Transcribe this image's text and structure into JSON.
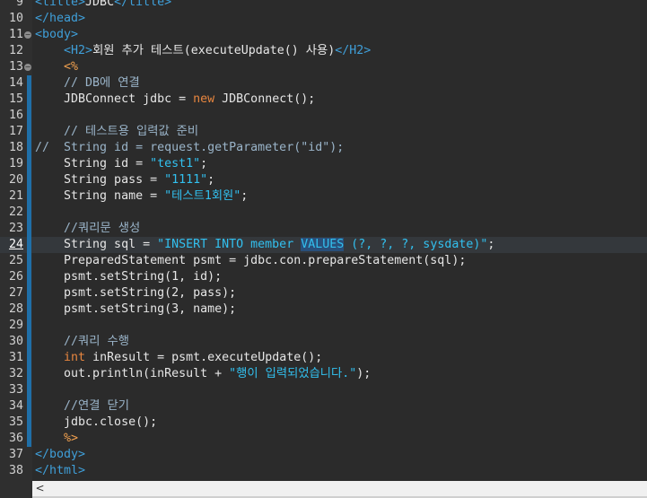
{
  "editor": {
    "lines": [
      {
        "n": "9",
        "fold": false,
        "bar": false,
        "segs": [
          {
            "c": "tag",
            "t": "<title>"
          },
          {
            "c": "plain",
            "t": "JDBC"
          },
          {
            "c": "tag",
            "t": "</title>"
          }
        ]
      },
      {
        "n": "10",
        "fold": false,
        "bar": false,
        "segs": [
          {
            "c": "tag",
            "t": "</head>"
          }
        ]
      },
      {
        "n": "11",
        "fold": true,
        "bar": false,
        "segs": [
          {
            "c": "tag",
            "t": "<body>"
          }
        ]
      },
      {
        "n": "12",
        "fold": false,
        "bar": false,
        "segs": [
          {
            "c": "plain",
            "t": "    "
          },
          {
            "c": "h2tag",
            "t": "<H2>"
          },
          {
            "c": "plain",
            "t": "회원 추가 테스트(executeUpdate() 사용)"
          },
          {
            "c": "h2tag",
            "t": "</H2>"
          }
        ]
      },
      {
        "n": "13",
        "fold": true,
        "bar": false,
        "segs": [
          {
            "c": "plain",
            "t": "    "
          },
          {
            "c": "scriptlet",
            "t": "<%"
          }
        ]
      },
      {
        "n": "14",
        "fold": false,
        "bar": true,
        "segs": [
          {
            "c": "comment",
            "t": "    // DB에 연결"
          }
        ]
      },
      {
        "n": "15",
        "fold": false,
        "bar": true,
        "segs": [
          {
            "c": "plain",
            "t": "    JDBConnect jdbc = "
          },
          {
            "c": "kw",
            "t": "new"
          },
          {
            "c": "plain",
            "t": " JDBConnect();"
          }
        ]
      },
      {
        "n": "16",
        "fold": false,
        "bar": true,
        "segs": []
      },
      {
        "n": "17",
        "fold": false,
        "bar": true,
        "segs": [
          {
            "c": "comment",
            "t": "    // 테스트용 입력값 준비"
          }
        ]
      },
      {
        "n": "18",
        "fold": false,
        "bar": true,
        "segs": [
          {
            "c": "comment",
            "t": "//  String id = request.getParameter(\"id\");"
          }
        ]
      },
      {
        "n": "19",
        "fold": false,
        "bar": true,
        "segs": [
          {
            "c": "plain",
            "t": "    String id = "
          },
          {
            "c": "str",
            "t": "\"test1\""
          },
          {
            "c": "plain",
            "t": ";"
          }
        ]
      },
      {
        "n": "20",
        "fold": false,
        "bar": true,
        "segs": [
          {
            "c": "plain",
            "t": "    String pass = "
          },
          {
            "c": "str",
            "t": "\"1111\""
          },
          {
            "c": "plain",
            "t": ";"
          }
        ]
      },
      {
        "n": "21",
        "fold": false,
        "bar": true,
        "segs": [
          {
            "c": "plain",
            "t": "    String name = "
          },
          {
            "c": "str",
            "t": "\"테스트1회원\""
          },
          {
            "c": "plain",
            "t": ";"
          }
        ]
      },
      {
        "n": "22",
        "fold": false,
        "bar": true,
        "segs": []
      },
      {
        "n": "23",
        "fold": false,
        "bar": true,
        "segs": [
          {
            "c": "comment",
            "t": "    //쿼리문 생성"
          }
        ]
      },
      {
        "n": "24",
        "fold": false,
        "bar": true,
        "current": true,
        "segs": [
          {
            "c": "plain",
            "t": "    String sql = "
          },
          {
            "c": "str",
            "t": "\"INSERT INTO member "
          },
          {
            "c": "str sel",
            "t": "VALUES"
          },
          {
            "c": "str",
            "t": " (?, ?, ?, sysdate)\""
          },
          {
            "c": "plain",
            "t": ";"
          }
        ]
      },
      {
        "n": "25",
        "fold": false,
        "bar": true,
        "segs": [
          {
            "c": "plain",
            "t": "    PreparedStatement psmt = jdbc.con.prepareStatement(sql);"
          }
        ]
      },
      {
        "n": "26",
        "fold": false,
        "bar": true,
        "segs": [
          {
            "c": "plain",
            "t": "    psmt.setString(1, id);"
          }
        ]
      },
      {
        "n": "27",
        "fold": false,
        "bar": true,
        "segs": [
          {
            "c": "plain",
            "t": "    psmt.setString(2, pass);"
          }
        ]
      },
      {
        "n": "28",
        "fold": false,
        "bar": true,
        "segs": [
          {
            "c": "plain",
            "t": "    psmt.setString(3, name);"
          }
        ]
      },
      {
        "n": "29",
        "fold": false,
        "bar": true,
        "segs": []
      },
      {
        "n": "30",
        "fold": false,
        "bar": true,
        "segs": [
          {
            "c": "comment",
            "t": "    //쿼리 수행"
          }
        ]
      },
      {
        "n": "31",
        "fold": false,
        "bar": true,
        "segs": [
          {
            "c": "plain",
            "t": "    "
          },
          {
            "c": "kw",
            "t": "int"
          },
          {
            "c": "plain",
            "t": " inResult = psmt.executeUpdate();"
          }
        ]
      },
      {
        "n": "32",
        "fold": false,
        "bar": true,
        "segs": [
          {
            "c": "plain",
            "t": "    out.println(inResult + "
          },
          {
            "c": "str",
            "t": "\"행이 입력되었습니다.\""
          },
          {
            "c": "plain",
            "t": ");"
          }
        ]
      },
      {
        "n": "33",
        "fold": false,
        "bar": true,
        "segs": []
      },
      {
        "n": "34",
        "fold": false,
        "bar": true,
        "segs": [
          {
            "c": "comment",
            "t": "    //연결 닫기"
          }
        ]
      },
      {
        "n": "35",
        "fold": false,
        "bar": true,
        "segs": [
          {
            "c": "plain",
            "t": "    jdbc.close();"
          }
        ]
      },
      {
        "n": "36",
        "fold": false,
        "bar": true,
        "segs": [
          {
            "c": "plain",
            "t": "    "
          },
          {
            "c": "scriptlet",
            "t": "%>"
          }
        ]
      },
      {
        "n": "37",
        "fold": false,
        "bar": false,
        "segs": [
          {
            "c": "tag",
            "t": "</body>"
          }
        ]
      },
      {
        "n": "38",
        "fold": false,
        "bar": false,
        "segs": [
          {
            "c": "tag",
            "t": "</html>"
          }
        ]
      }
    ]
  },
  "scrollbar": {
    "left_arrow": "<"
  },
  "colors": {
    "background": "#2b2b2b",
    "tag": "#3f9fd9",
    "keyword": "#e8863f",
    "string": "#32c0ef",
    "comment": "#9ab4c9",
    "scriptlet": "#f2a14f",
    "selection": "#294f7a"
  }
}
